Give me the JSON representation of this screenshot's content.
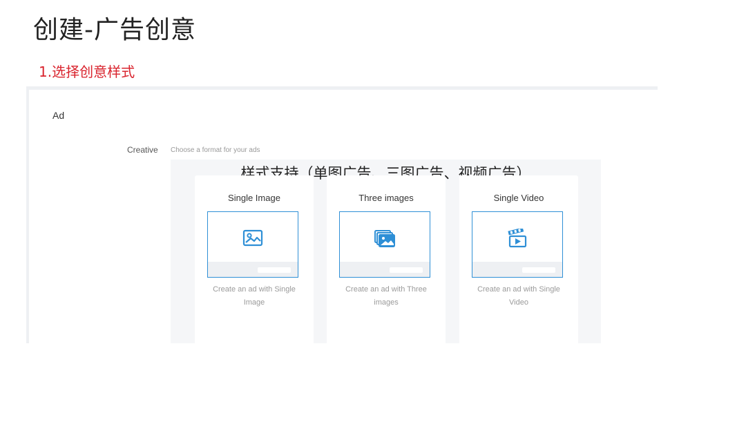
{
  "page": {
    "title": "创建-广告创意",
    "step_title": "1.选择创意样式"
  },
  "panel": {
    "ad_label": "Ad",
    "creative_label": "Creative",
    "creative_hint": "Choose a format for your ads",
    "support_note": "样式支持（单图广告、三图广告、视频广告）"
  },
  "formats": [
    {
      "title": "Single Image",
      "icon": "image-icon",
      "description": "Create an ad with Single Image"
    },
    {
      "title": "Three images",
      "icon": "images-stack-icon",
      "description": "Create an ad with Three images"
    },
    {
      "title": "Single Video",
      "icon": "video-clapper-icon",
      "description": "Create an ad with Single Video"
    }
  ],
  "colors": {
    "accent": "#2e8fd6",
    "step_title": "#d9232d",
    "panel_border": "#eef0f3"
  }
}
